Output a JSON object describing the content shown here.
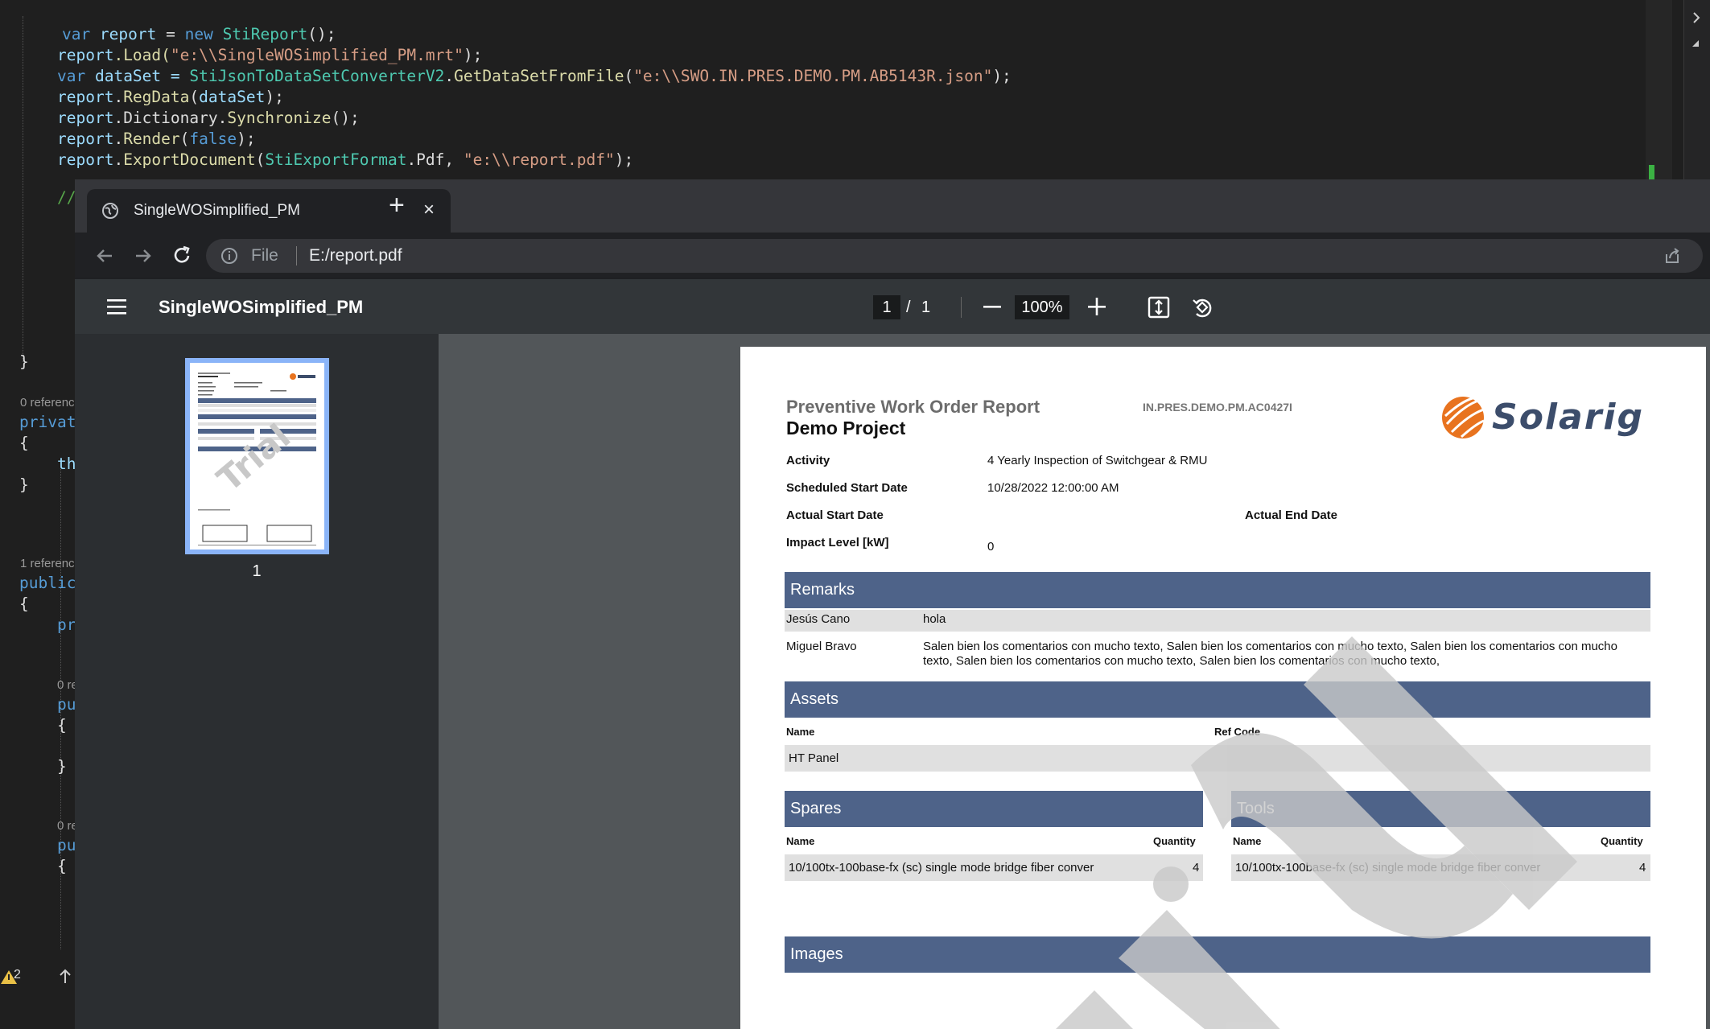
{
  "editor": {
    "code": {
      "l1": "    var report = new StiReport();",
      "l2_a": "report",
      "l2_b": ".Load(",
      "l2_c": "\"e:\\\\SingleWOSimplified_PM.mrt\"",
      "l2_d": ");",
      "l3_a": "var",
      "l3_b": " dataSet = ",
      "l3_c": "StiJsonToDataSetConverterV2",
      "l3_d": ".",
      "l3_e": "GetDataSetFromFile",
      "l3_f": "(",
      "l3_g": "\"e:\\\\SWO.IN.PRES.DEMO.PM.AB5143R.json\"",
      "l3_h": ");",
      "l4_a": "report",
      "l4_b": ".",
      "l4_c": "RegData",
      "l4_d": "(",
      "l4_e": "dataSet",
      "l4_f": ");",
      "l5_a": "report",
      "l5_b": ".Dictionary.",
      "l5_c": "Synchronize",
      "l5_d": "();",
      "l6_a": "report",
      "l6_b": ".",
      "l6_c": "Render",
      "l6_d": "(",
      "l6_e": "false",
      "l6_f": ");",
      "l7_a": "report",
      "l7_b": ".",
      "l7_c": "ExportDocument",
      "l7_d": "(",
      "l7_e": "StiExportFormat",
      "l7_f": ".Pdf, ",
      "l7_g": "\"e:\\\\report.pdf\"",
      "l7_h": ");",
      "l8": "//",
      "brace_close": "}",
      "open_brace": "{",
      "private": "privat",
      "this_kw": "th",
      "public": "public",
      "pr": "pr",
      "pu": "pu"
    },
    "codelens": {
      "zero_refs": "0 referenc",
      "one_ref": "1 referenc",
      "zero_r": "0 re",
      "zero_r2": "0 re"
    },
    "status": {
      "warnings": "2"
    }
  },
  "browser": {
    "tab_title": "SingleWOSimplified_PM",
    "tab_close": "×",
    "new_tab": "+",
    "file_label": "File",
    "url": "E:/report.pdf"
  },
  "pdf_toolbar": {
    "title": "SingleWOSimplified_PM",
    "current_page": "1",
    "page_sep": "/",
    "total_pages": "1",
    "zoom": "100%"
  },
  "sidebar": {
    "thumb_page_number": "1"
  },
  "report": {
    "title": "Preventive Work Order Report",
    "project": "Demo Project",
    "code": "IN.PRES.DEMO.PM.AC0427I",
    "logo_text": "Solarig",
    "fields": {
      "activity_label": "Activity",
      "activity_value": "4 Yearly Inspection of Switchgear & RMU",
      "scheduled_label": "Scheduled Start Date",
      "scheduled_value": "10/28/2022 12:00:00 AM",
      "actual_start_label": "Actual Start Date",
      "actual_end_label": "Actual End Date",
      "impact_label": "Impact Level [kW]",
      "impact_value": "0"
    },
    "remarks": {
      "heading": "Remarks",
      "rows": [
        {
          "author": "Jesús Cano",
          "text": "hola"
        },
        {
          "author": "Miguel Bravo",
          "text": "Salen bien los comentarios con mucho texto, Salen bien los comentarios con mucho texto, Salen bien los comentarios con mucho",
          "text2": "texto, Salen bien los comentarios con mucho texto, Salen bien los comentarios con mucho texto,"
        }
      ]
    },
    "assets": {
      "heading": "Assets",
      "col_name": "Name",
      "col_ref": "Ref Code",
      "rows": [
        {
          "name": "HT Panel",
          "ref": ""
        }
      ]
    },
    "spares": {
      "heading": "Spares",
      "col_name": "Name",
      "col_qty": "Quantity",
      "rows": [
        {
          "name": "10/100tx-100base-fx (sc) single mode bridge fiber conver",
          "qty": "4"
        }
      ]
    },
    "tools": {
      "heading": "Tools",
      "col_name": "Name",
      "col_qty": "Quantity",
      "rows": [
        {
          "name": "10/100tx-100base-fx (sc) single mode bridge fiber conver",
          "qty": "4"
        }
      ]
    },
    "images": {
      "heading": "Images"
    },
    "watermark": "Trial"
  },
  "colors": {
    "band": "#4e6389",
    "accent": "#8ab4f8",
    "logo_orange": "#e8731f",
    "logo_navy": "#3c4d6b"
  }
}
